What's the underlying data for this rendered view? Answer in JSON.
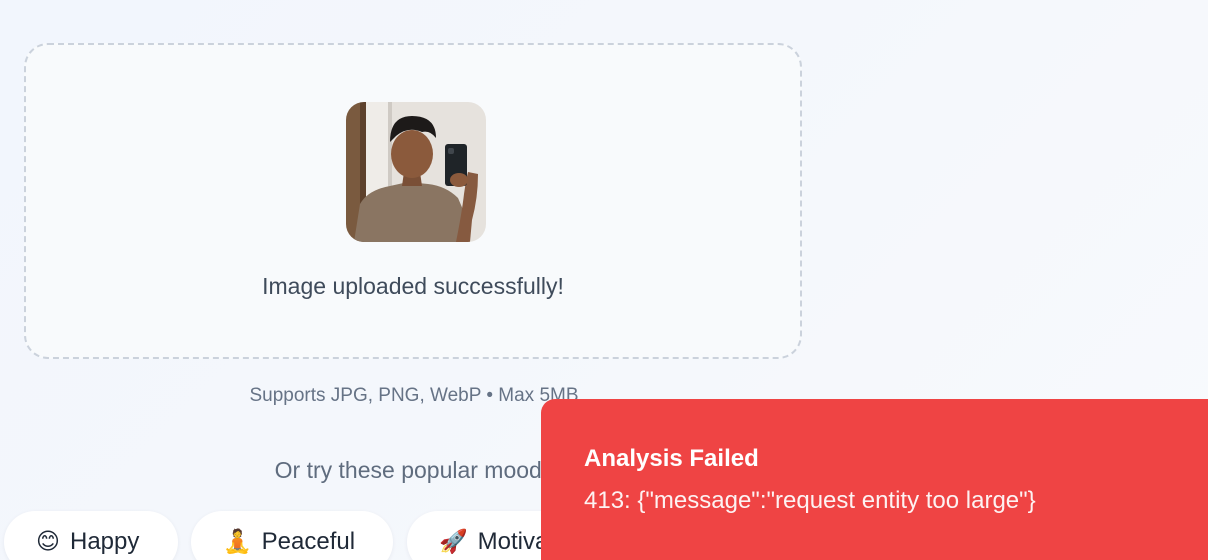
{
  "upload": {
    "status_text": "Image uploaded successfully!",
    "formats_text": "Supports JPG, PNG, WebP • Max 5MB"
  },
  "moods": {
    "prompt": "Or try these popular moods",
    "items": [
      {
        "emoji": "😊",
        "label": "Happy"
      },
      {
        "emoji": "🧘",
        "label": "Peaceful"
      },
      {
        "emoji": "🚀",
        "label": "Motivated"
      }
    ]
  },
  "toast": {
    "title": "Analysis Failed",
    "message": "413: {\"message\":\"request entity too large\"}",
    "color": "#ef4444"
  }
}
